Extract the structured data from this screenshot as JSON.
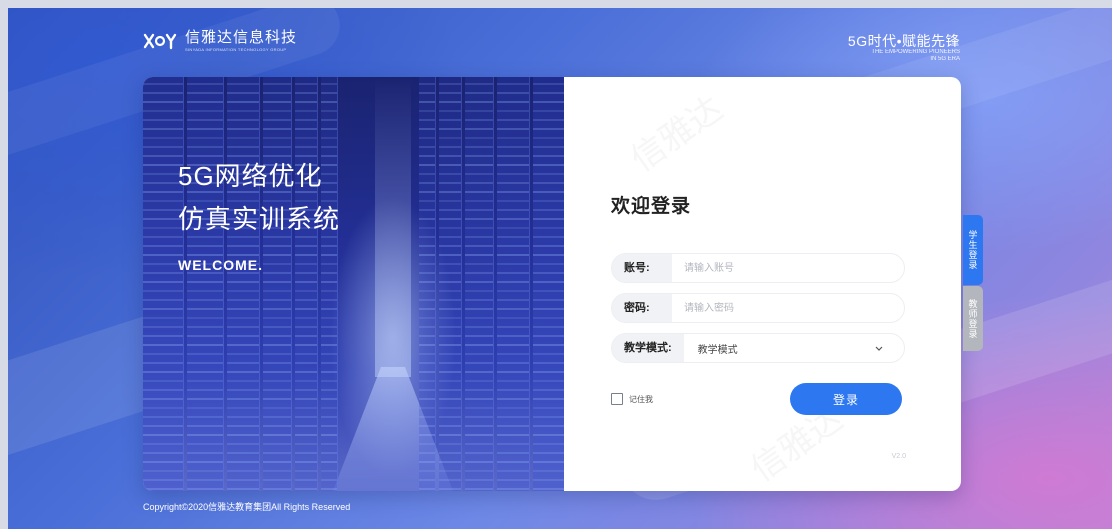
{
  "header": {
    "logo_text": "信雅达信息科技",
    "logo_subtext": "SINYADA INFORMATION TECHNOLOGY GROUP",
    "slogan_main": "5G时代•赋能先锋",
    "slogan_sub_line1": "THE EMPOWERING PIONEERS",
    "slogan_sub_line2": "IN 5G ERA"
  },
  "hero": {
    "title_line1": "5G网络优化",
    "title_line2": "仿真实训系统",
    "welcome": "WELCOME."
  },
  "form": {
    "title": "欢迎登录",
    "account_label": "账号:",
    "account_placeholder": "请输入账号",
    "password_label": "密码:",
    "password_placeholder": "请输入密码",
    "mode_label": "教学模式:",
    "mode_value": "教学模式",
    "remember_label": "记住我",
    "login_label": "登录",
    "version": "V2.0",
    "watermark": "信雅达"
  },
  "side_tabs": {
    "student": "学生登录",
    "teacher": "教师登录"
  },
  "footer": {
    "copyright": "Copyright©2020信雅达教育集团All Rights Reserved"
  },
  "colors": {
    "primary": "#2d77f0",
    "inactive_tab": "#b3b6bd",
    "background": "#4a6fd8"
  },
  "icons": {
    "logo": "xy-logo-icon",
    "select_arrow": "chevron-down-icon",
    "remember": "checkbox-icon"
  }
}
